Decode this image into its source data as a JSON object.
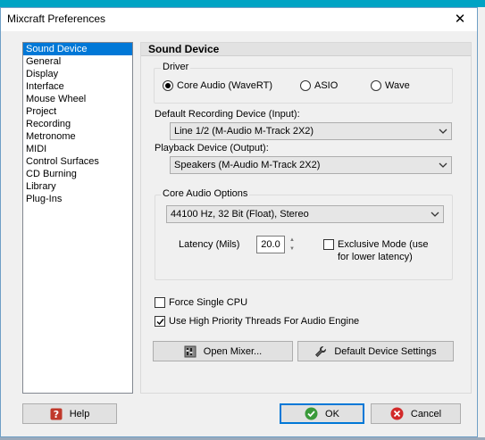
{
  "window": {
    "title": "Mixcraft Preferences",
    "close_glyph": "✕"
  },
  "nav": {
    "items": [
      {
        "label": "Sound Device",
        "selected": true
      },
      {
        "label": "General"
      },
      {
        "label": "Display"
      },
      {
        "label": "Interface"
      },
      {
        "label": "Mouse Wheel"
      },
      {
        "label": "Project"
      },
      {
        "label": "Recording"
      },
      {
        "label": "Metronome"
      },
      {
        "label": "MIDI"
      },
      {
        "label": "Control Surfaces"
      },
      {
        "label": "CD Burning"
      },
      {
        "label": "Library"
      },
      {
        "label": "Plug-Ins"
      }
    ]
  },
  "panel": {
    "title": "Sound Device",
    "driver": {
      "group_label": "Driver",
      "options": [
        {
          "label": "Core Audio (WaveRT)",
          "checked": true
        },
        {
          "label": "ASIO",
          "checked": false
        },
        {
          "label": "Wave",
          "checked": false
        }
      ]
    },
    "recording_device": {
      "label": "Default Recording Device (Input):",
      "value": "Line 1/2 (M-Audio M-Track 2X2)"
    },
    "playback_device": {
      "label": "Playback Device (Output):",
      "value": "Speakers (M-Audio M-Track 2X2)"
    },
    "core_audio": {
      "group_label": "Core Audio Options",
      "format_value": "44100 Hz, 32 Bit (Float), Stereo",
      "latency_label": "Latency (Mils)",
      "latency_value": "20.0",
      "exclusive_label": "Exclusive Mode (use for lower latency)",
      "exclusive_checked": false
    },
    "force_single_cpu": {
      "label": "Force Single CPU",
      "checked": false
    },
    "high_priority": {
      "label": "Use High Priority Threads For Audio Engine",
      "checked": true
    },
    "open_mixer_label": "Open Mixer...",
    "default_settings_label": "Default Device Settings"
  },
  "footer": {
    "help_label": "Help",
    "ok_label": "OK",
    "cancel_label": "Cancel"
  },
  "colors": {
    "selection": "#0078d7",
    "ok_icon": "#3a9a3a",
    "cancel_icon": "#d22a2a",
    "help_icon": "#c0392b"
  },
  "icons": {
    "help": "question-icon",
    "ok": "checkmark-circle-icon",
    "cancel": "cancel-circle-icon",
    "mixer": "mixer-icon",
    "default_settings": "wrench-icon"
  }
}
